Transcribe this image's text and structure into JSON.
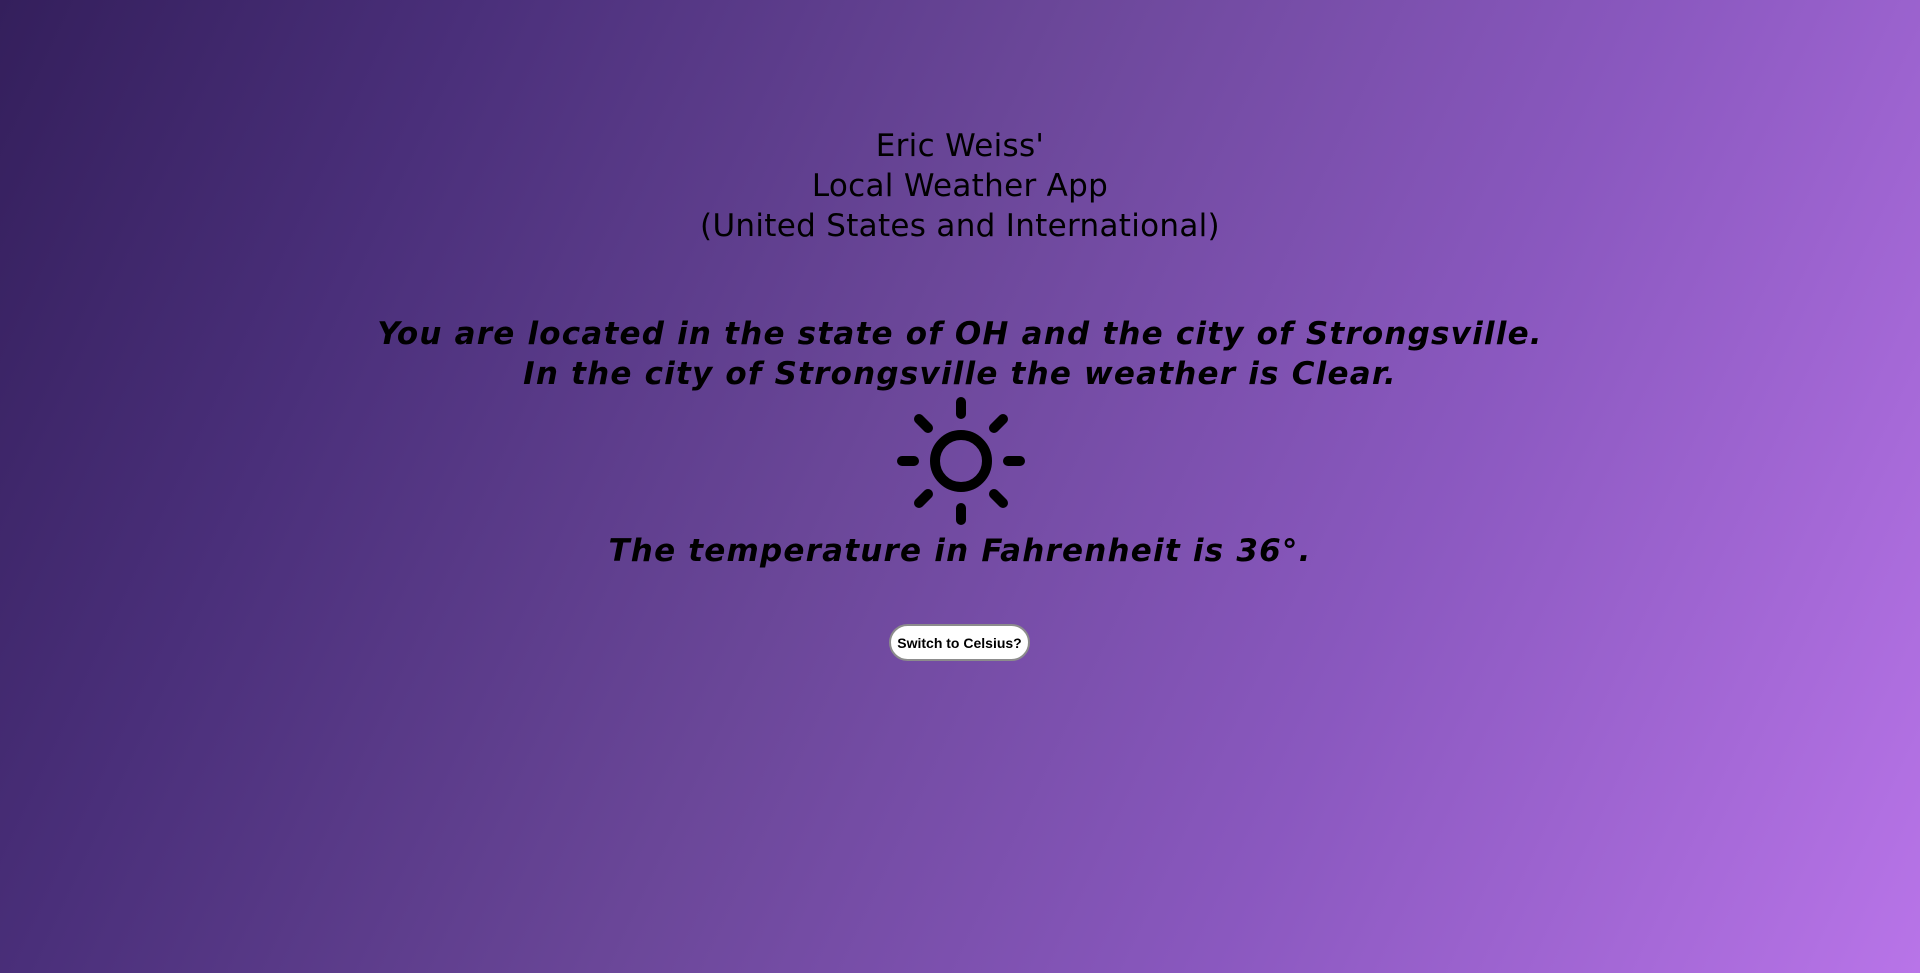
{
  "header": {
    "line1": "Eric Weiss'",
    "line2": "Local Weather App",
    "line3": "(United States and International)"
  },
  "location": {
    "location_text": "You are located in the state of OH and the city of Strongsville.",
    "weather_text": "In the city of Strongsville the weather is Clear."
  },
  "weather_icon": "sun-icon",
  "temperature": {
    "text": "The temperature in Fahrenheit is 36°."
  },
  "toggle": {
    "label": "Switch to Celsius?"
  }
}
